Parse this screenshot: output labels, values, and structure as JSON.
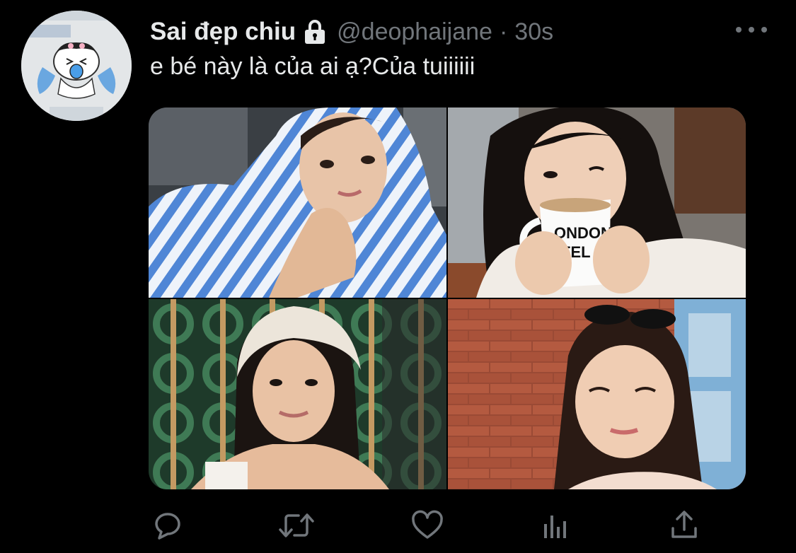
{
  "tweet": {
    "display_name": "Sai đẹp chiu",
    "handle": "@deophaijane",
    "separator": "·",
    "time": "30s",
    "text": "e bé này là của ai ạ?Của tuiiiiii",
    "protected_icon": "lock-icon",
    "more_icon": "more-dots-icon"
  },
  "media": {
    "photos": [
      {
        "name": "photo-1",
        "alt": "girl with blue striped shirt over head"
      },
      {
        "name": "photo-2",
        "alt": "girl holding white coffee mug"
      },
      {
        "name": "photo-3",
        "alt": "girl with lace headscarf in front of green lattice"
      },
      {
        "name": "photo-4",
        "alt": "girl squinting next to brick wall"
      }
    ]
  },
  "actions": [
    {
      "name": "reply-button",
      "icon": "reply-icon"
    },
    {
      "name": "retweet-button",
      "icon": "retweet-icon"
    },
    {
      "name": "like-button",
      "icon": "heart-icon"
    },
    {
      "name": "analytics-button",
      "icon": "analytics-icon"
    },
    {
      "name": "share-button",
      "icon": "share-icon"
    }
  ],
  "colors": {
    "background": "#000000",
    "primary_text": "#e7e9ea",
    "secondary_text": "#71767b"
  }
}
